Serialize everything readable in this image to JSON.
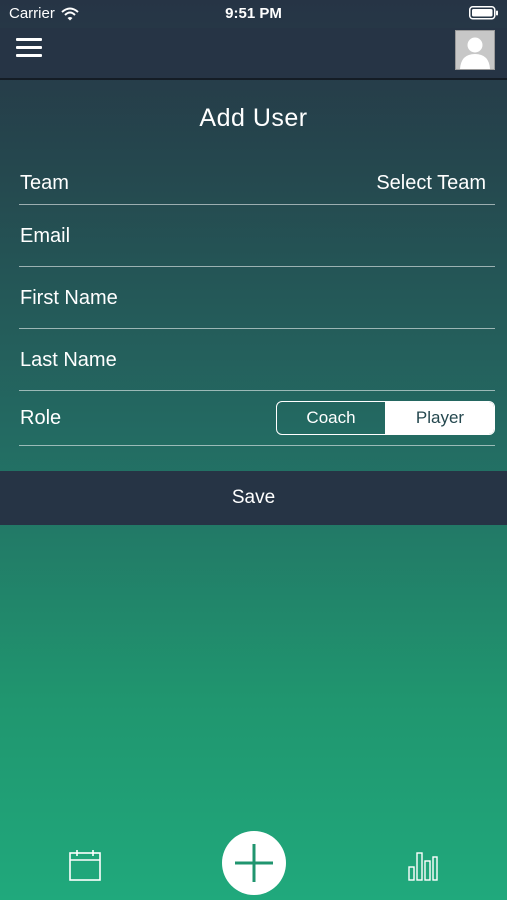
{
  "status_bar": {
    "carrier": "Carrier",
    "time": "9:51 PM",
    "wifi_icon": "wifi-icon",
    "battery_icon": "battery-icon"
  },
  "nav": {
    "menu_icon": "hamburger-menu-icon",
    "avatar_icon": "user-avatar-icon"
  },
  "form": {
    "title": "Add User",
    "team": {
      "label": "Team",
      "value": "Select Team"
    },
    "email": {
      "label": "Email"
    },
    "first_name": {
      "label": "First Name"
    },
    "last_name": {
      "label": "Last Name"
    },
    "role": {
      "label": "Role",
      "options": [
        "Coach",
        "Player"
      ],
      "selected": "Player"
    }
  },
  "save_label": "Save",
  "tab_bar": {
    "left_icon": "calendar-icon",
    "center_icon": "plus-icon",
    "right_icon": "bar-chart-icon"
  },
  "colors": {
    "header": "#263445",
    "gradient_top": "#25494f",
    "gradient_bottom": "#20a97c",
    "accent_text": "#25484f"
  }
}
